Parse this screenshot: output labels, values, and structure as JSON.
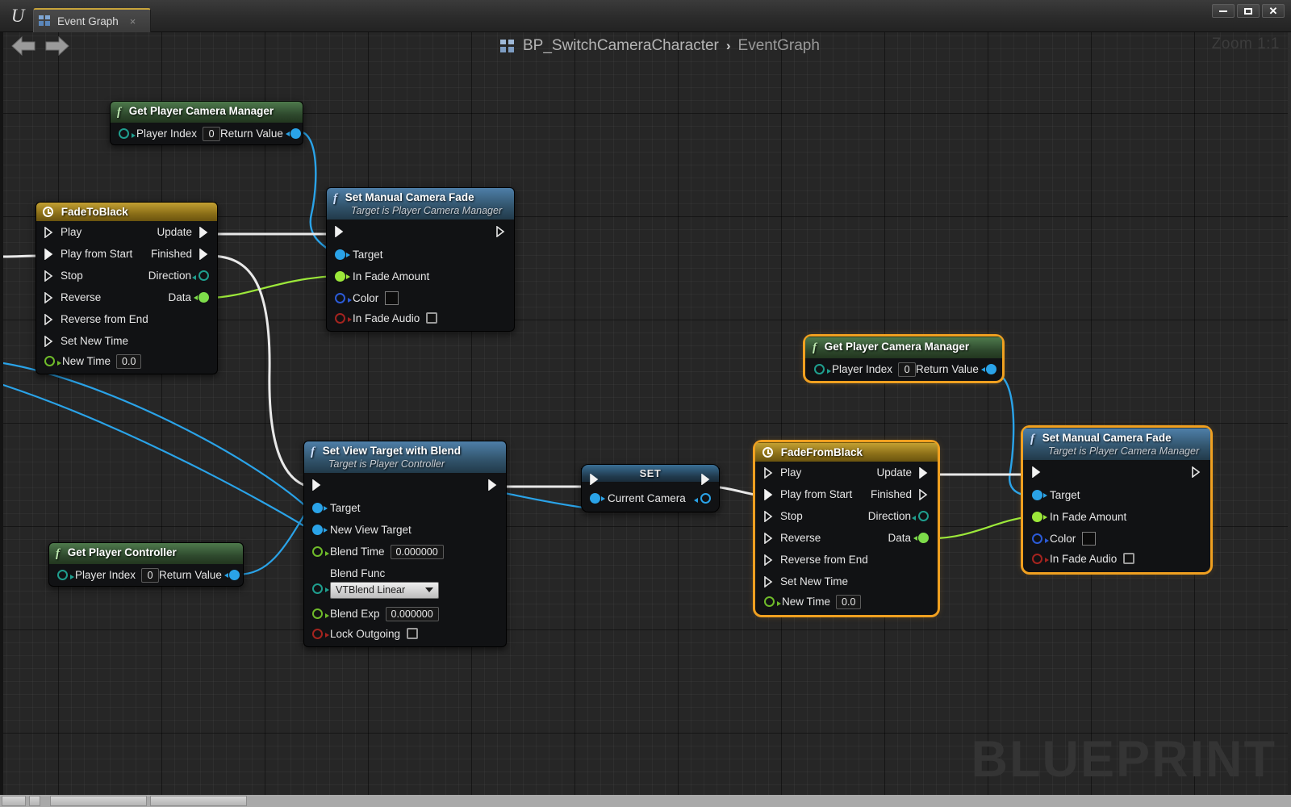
{
  "window": {
    "tab_label": "Event Graph",
    "tab_close": "×",
    "minimize": "–",
    "maximize": "□",
    "close": "✕",
    "logo": "U"
  },
  "toolbar": {
    "back_icon": "arrow-left-icon",
    "forward_icon": "arrow-right-icon",
    "zoom_label": "Zoom 1:1"
  },
  "breadcrumb": {
    "root": "BP_SwitchCameraCharacter",
    "separator": "›",
    "leaf": "EventGraph"
  },
  "canvas": {
    "watermark": "BLUEPRINT",
    "bg_color": "#262626",
    "grid_color": "#1e1e1e"
  },
  "colors": {
    "selection": "#f0a020",
    "exec_wire": "#e8e8e8",
    "object_wire": "#2aa3e8",
    "float_wire": "#9ce83a",
    "function_header": "#33566f",
    "pure_header": "#2f4a2e",
    "timeline_header": "#8a6e18"
  },
  "nodes": {
    "get_camera_manager_1": {
      "title": "Get Player Camera Manager",
      "in_label": "Player Index",
      "in_value": "0",
      "out_label": "Return Value"
    },
    "fade_to_black": {
      "title": "FadeToBlack",
      "inputs": [
        "Play",
        "Play from Start",
        "Stop",
        "Reverse",
        "Reverse from End",
        "Set New Time"
      ],
      "new_time_label": "New Time",
      "new_time_value": "0.0",
      "outputs": [
        "Update",
        "Finished",
        "Direction",
        "Data"
      ]
    },
    "set_manual_camera_fade_1": {
      "title": "Set Manual Camera Fade",
      "subtitle": "Target is Player Camera Manager",
      "pins": [
        "Target",
        "In Fade Amount",
        "Color",
        "In Fade Audio"
      ]
    },
    "set_view_target_with_blend": {
      "title": "Set View Target with Blend",
      "subtitle": "Target is Player Controller",
      "target_label": "Target",
      "new_view_target_label": "New View Target",
      "blend_time_label": "Blend Time",
      "blend_time_value": "0.000000",
      "blend_func_label": "Blend Func",
      "blend_func_value": "VTBlend Linear",
      "blend_exp_label": "Blend Exp",
      "blend_exp_value": "0.000000",
      "lock_outgoing_label": "Lock Outgoing"
    },
    "get_player_controller": {
      "title": "Get Player Controller",
      "in_label": "Player Index",
      "in_value": "0",
      "out_label": "Return Value"
    },
    "set_current_camera": {
      "title": "SET",
      "variable_label": "Current Camera"
    },
    "get_camera_manager_2": {
      "title": "Get Player Camera Manager",
      "in_label": "Player Index",
      "in_value": "0",
      "out_label": "Return Value",
      "selected": true
    },
    "fade_from_black": {
      "title": "FadeFromBlack",
      "inputs": [
        "Play",
        "Play from Start",
        "Stop",
        "Reverse",
        "Reverse from End",
        "Set New Time"
      ],
      "new_time_label": "New Time",
      "new_time_value": "0.0",
      "outputs": [
        "Update",
        "Finished",
        "Direction",
        "Data"
      ],
      "selected": true
    },
    "set_manual_camera_fade_2": {
      "title": "Set Manual Camera Fade",
      "subtitle": "Target is Player Camera Manager",
      "pins": [
        "Target",
        "In Fade Amount",
        "Color",
        "In Fade Audio"
      ],
      "selected": true
    }
  }
}
